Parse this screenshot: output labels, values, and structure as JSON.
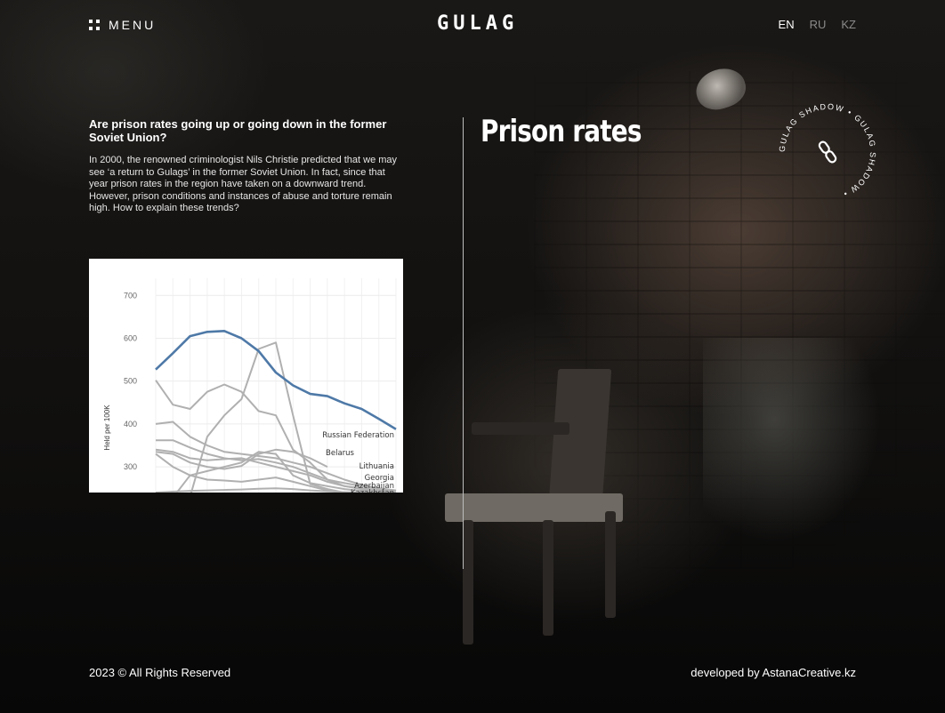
{
  "header": {
    "menu_label": "MENU",
    "logo": "GULAG",
    "languages": [
      "EN",
      "RU",
      "KZ"
    ],
    "active_language": "EN"
  },
  "section": {
    "title": "Prison rates",
    "question": "Are prison rates going up or going down in the former Soviet Union?",
    "intro": "In 2000, the renowned criminologist Nils Christie predicted that we may see ‘a return to Gulags’ in the former Soviet Union. In fact, since that year prison rates in the region have taken on a downward trend. However, prison conditions and instances of abuse and torture remain high. How to explain these trends?"
  },
  "badge": {
    "ring_text": "GULAG SHADOW • GULAG SHADOW • "
  },
  "footer": {
    "copyright": "2023 © All Rights Reserved",
    "credit": "developed by AstanaCreative.kz"
  },
  "colors": {
    "highlight": "#4e79a7",
    "muted": "#b0b0b0",
    "background": "#0d0c0b"
  },
  "chart_data": {
    "type": "line",
    "ylabel": "Held per 100K",
    "yticks": [
      300,
      400,
      500,
      600,
      700
    ],
    "ylim": [
      240,
      740
    ],
    "x": [
      0,
      1,
      2,
      3,
      4,
      5,
      6,
      7,
      8,
      9,
      10,
      11,
      12,
      13,
      14
    ],
    "series": [
      {
        "name": "Russian Federation",
        "highlight": true,
        "values": [
          527,
          565,
          605,
          615,
          617,
          600,
          570,
          520,
          490,
          470,
          465,
          448,
          435,
          412,
          388
        ]
      },
      {
        "name": "Belarus",
        "values": [
          335,
          330,
          310,
          300,
          295,
          302,
          330,
          340,
          335,
          320,
          300,
          null,
          null,
          null,
          null
        ]
      },
      {
        "name": "Lithuania",
        "values": [
          362,
          362,
          345,
          330,
          320,
          315,
          318,
          310,
          300,
          285,
          270,
          262,
          255,
          250,
          245
        ]
      },
      {
        "name": "Georgia",
        "values": [
          502,
          445,
          435,
          475,
          492,
          475,
          430,
          420,
          340,
          310,
          270,
          255,
          248,
          242,
          238
        ]
      },
      {
        "name": "Azerbaijan",
        "values": [
          240,
          242,
          244,
          245,
          246,
          247,
          249,
          250,
          248,
          245,
          243,
          241,
          240,
          239,
          238
        ]
      },
      {
        "name": "Kazakhstan",
        "values": [
          null,
          null,
          230,
          370,
          420,
          458,
          575,
          590,
          420,
          260,
          248,
          240,
          235,
          232,
          230
        ]
      },
      {
        "name": "",
        "values": [
          400,
          405,
          370,
          350,
          335,
          330,
          325,
          320,
          310,
          300,
          285,
          270,
          258,
          250,
          244
        ]
      },
      {
        "name": "",
        "values": [
          340,
          335,
          320,
          315,
          318,
          320,
          310,
          300,
          290,
          280,
          265,
          255,
          250,
          246,
          242
        ]
      },
      {
        "name": "",
        "values": [
          330,
          300,
          280,
          270,
          268,
          265,
          270,
          275,
          265,
          255,
          245,
          240,
          236,
          234,
          232
        ]
      },
      {
        "name": "",
        "values": [
          235,
          228,
          280,
          290,
          300,
          310,
          335,
          330,
          280,
          262,
          255,
          248,
          244,
          240,
          236
        ]
      }
    ]
  }
}
